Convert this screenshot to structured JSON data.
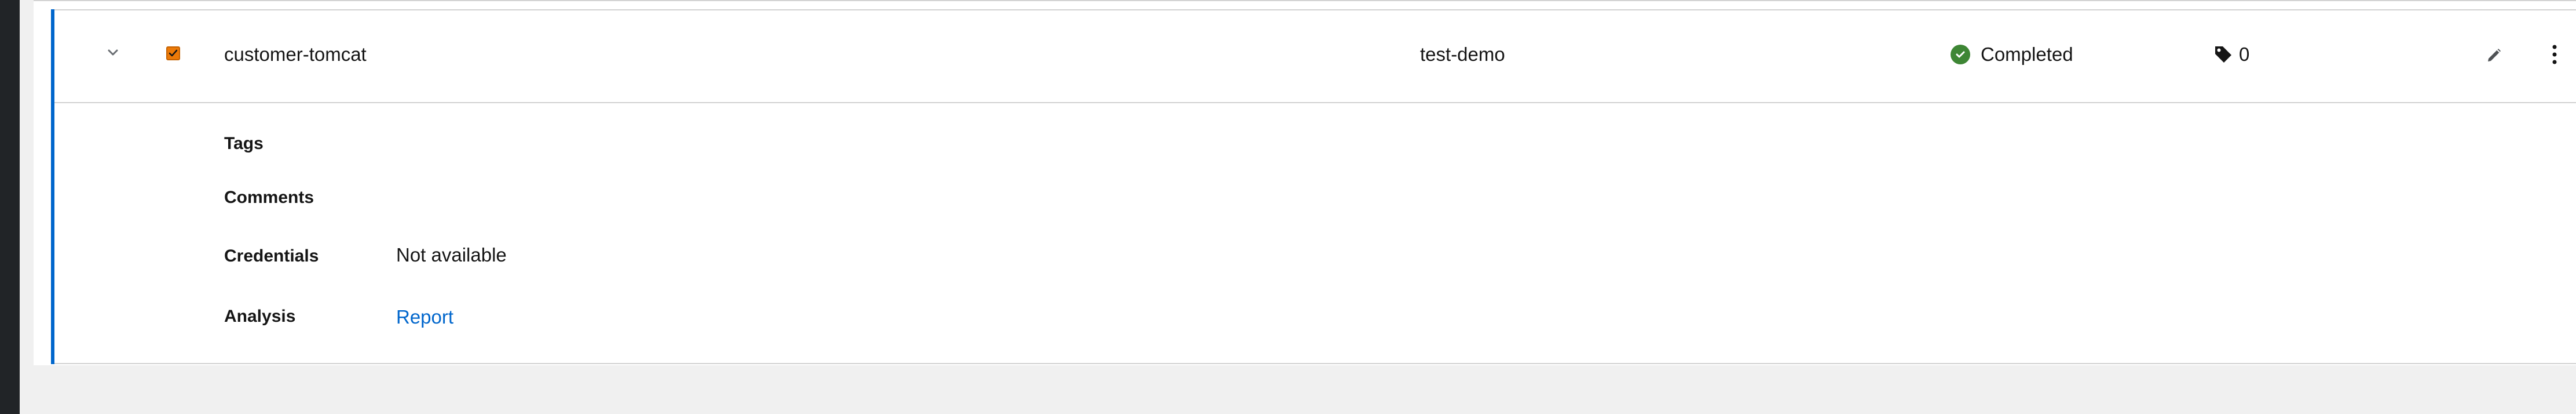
{
  "row": {
    "name": "customer-tomcat",
    "business_service": "test-demo",
    "status": "Completed",
    "tag_count": "0",
    "checked": true
  },
  "details": [
    {
      "label": "Tags",
      "value": ""
    },
    {
      "label": "Comments",
      "value": ""
    },
    {
      "label": "Credentials",
      "value": "Not available"
    },
    {
      "label": "Analysis",
      "value": "Report"
    }
  ],
  "icons": {
    "toggle": "chevron-down-icon",
    "checkbox": "checkbox-checked-icon",
    "status": "check-circle-icon",
    "tag": "tag-icon",
    "edit": "pencil-icon",
    "kebab": "kebab-icon"
  },
  "colors": {
    "accent": "#0066cc",
    "checkbox": "#ec7a08",
    "status_success": "#3e8635",
    "sidebar": "#212427"
  }
}
